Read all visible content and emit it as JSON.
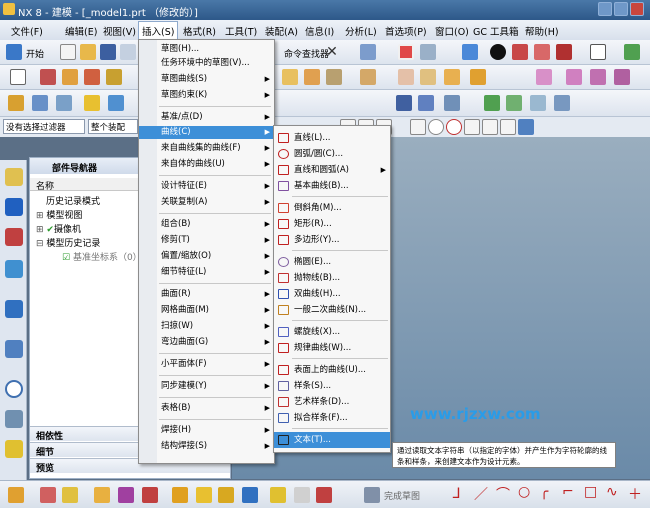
{
  "window": {
    "title": "NX 8 - 建模 - [_model1.prt （修改的）]"
  },
  "menubar": [
    {
      "label": "文件(F)"
    },
    {
      "label": "编辑(E)"
    },
    {
      "label": "视图(V)"
    },
    {
      "label": "插入(S)"
    },
    {
      "label": "格式(R)"
    },
    {
      "label": "工具(T)"
    },
    {
      "label": "装配(A)"
    },
    {
      "label": "信息(I)"
    },
    {
      "label": "分析(L)"
    },
    {
      "label": "首选项(P)"
    },
    {
      "label": "窗口(O)"
    },
    {
      "label": "GC 工具箱"
    },
    {
      "label": "帮助(H)"
    }
  ],
  "toolbar": {
    "start_label": "开始",
    "assembly_navigator": "命令查找器"
  },
  "filterbar": {
    "filter": "没有选择过滤器",
    "scope": "整个装配"
  },
  "navigator": {
    "title": "部件导航器",
    "col_name": "名称",
    "rows": [
      "历史记录模式",
      "模型视图",
      "摄像机",
      "模型历史记录",
      "基准坐标系（0）"
    ],
    "sections": [
      "相依性",
      "细节",
      "预览"
    ]
  },
  "insert_menu": [
    {
      "label": "草图(H)...",
      "arrow": false
    },
    {
      "label": "任务环境中的草图(V)...",
      "arrow": false
    },
    {
      "label": "草图曲线(S)",
      "arrow": true
    },
    {
      "label": "草图约束(K)",
      "arrow": true
    },
    {
      "label": "基准/点(D)",
      "arrow": true
    },
    {
      "label": "曲线(C)",
      "arrow": true
    },
    {
      "label": "来自曲线集的曲线(F)",
      "arrow": true
    },
    {
      "label": "来自体的曲线(U)",
      "arrow": true
    },
    {
      "label": "设计特征(E)",
      "arrow": true
    },
    {
      "label": "关联复制(A)",
      "arrow": true
    },
    {
      "label": "组合(B)",
      "arrow": true
    },
    {
      "label": "修剪(T)",
      "arrow": true
    },
    {
      "label": "偏置/缩放(O)",
      "arrow": true
    },
    {
      "label": "细节特征(L)",
      "arrow": true
    },
    {
      "label": "曲面(R)",
      "arrow": true
    },
    {
      "label": "网格曲面(M)",
      "arrow": true
    },
    {
      "label": "扫掠(W)",
      "arrow": true
    },
    {
      "label": "弯边曲面(G)",
      "arrow": true
    },
    {
      "label": "小平面体(F)",
      "arrow": true
    },
    {
      "label": "同步建模(Y)",
      "arrow": true
    },
    {
      "label": "表格(B)",
      "arrow": true
    },
    {
      "label": "焊接(H)",
      "arrow": true
    },
    {
      "label": "结构焊接(S)",
      "arrow": true
    }
  ],
  "curve_menu": [
    {
      "label": "直线(L)...",
      "arrow": false
    },
    {
      "label": "圆弧/圆(C)...",
      "arrow": false
    },
    {
      "label": "直线和圆弧(A)",
      "arrow": true
    },
    {
      "label": "基本曲线(B)...",
      "arrow": false
    },
    {
      "label": "倒斜角(M)...",
      "arrow": false
    },
    {
      "label": "矩形(R)...",
      "arrow": false
    },
    {
      "label": "多边形(Y)...",
      "arrow": false
    },
    {
      "label": "椭圆(E)...",
      "arrow": false
    },
    {
      "label": "抛物线(B)...",
      "arrow": false
    },
    {
      "label": "双曲线(H)...",
      "arrow": false
    },
    {
      "label": "一般二次曲线(N)...",
      "arrow": false
    },
    {
      "label": "螺旋线(X)...",
      "arrow": false
    },
    {
      "label": "规律曲线(W)...",
      "arrow": false
    },
    {
      "label": "表面上的曲线(U)...",
      "arrow": false
    },
    {
      "label": "样条(S)...",
      "arrow": false
    },
    {
      "label": "艺术样条(D)...",
      "arrow": false
    },
    {
      "label": "拟合样条(F)...",
      "arrow": false
    },
    {
      "label": "文本(T)...",
      "arrow": false
    }
  ],
  "tooltip": "通过读取文本字符串（以指定的字体）并产生作为字符轮廓的线条和样条，来创建文本作为设计元素。",
  "watermark": "www.rjzxw.com",
  "bottombar": {
    "finish_sketch": "完成草图"
  }
}
